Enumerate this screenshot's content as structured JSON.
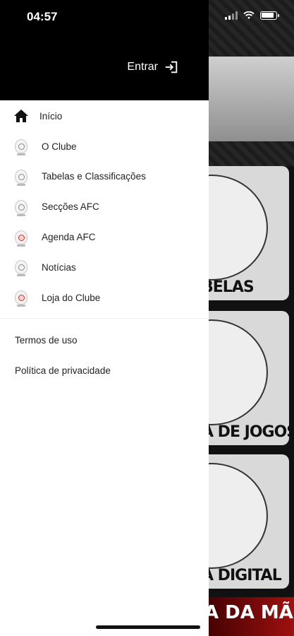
{
  "status_bar": {
    "time": "04:57"
  },
  "drawer": {
    "login_label": "Entrar",
    "menu": [
      {
        "label": "Início",
        "icon": "home-icon"
      },
      {
        "label": "O Clube",
        "icon": "club-crest-icon"
      },
      {
        "label": "Tabelas e Classificações",
        "icon": "club-crest-icon"
      },
      {
        "label": "Secções AFC",
        "icon": "club-crest-icon"
      },
      {
        "label": "Agenda AFC",
        "icon": "club-crest-icon"
      },
      {
        "label": "Notícias",
        "icon": "club-crest-icon"
      },
      {
        "label": "Loja do Clube",
        "icon": "club-crest-icon"
      }
    ],
    "legal": [
      {
        "label": "Termos de uso"
      },
      {
        "label": "Política de privacidade"
      }
    ]
  },
  "background": {
    "cards": [
      {
        "label": "BELAS"
      },
      {
        "label": "A DE JOGOS"
      },
      {
        "label": "A DIGITAL"
      }
    ],
    "bottom_banner": "A DA MÃO"
  },
  "colors": {
    "drawer_header": "#000000",
    "drawer_bg": "#ffffff",
    "accent_red": "#c0392b"
  }
}
